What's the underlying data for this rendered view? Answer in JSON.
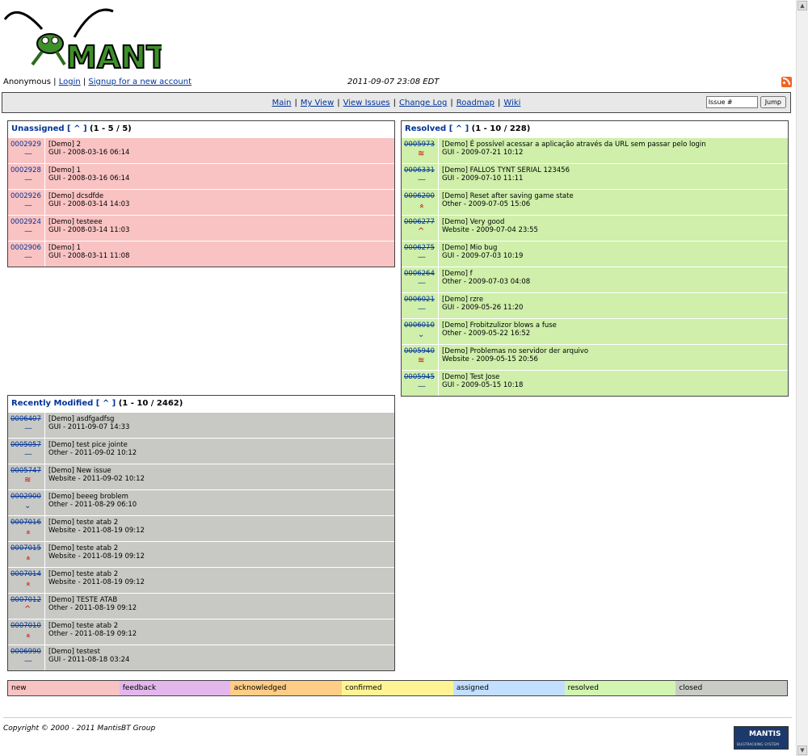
{
  "header": {
    "logo_text": "MANTIS",
    "user": "Anonymous",
    "login": "Login",
    "signup": "Signup for a new account",
    "datetime": "2011-09-07 23:08 EDT",
    "rss_icon": "rss-feed-icon"
  },
  "menu": {
    "items": [
      "Main",
      "My View",
      "View Issues",
      "Change Log",
      "Roadmap",
      "Wiki"
    ],
    "jump_placeholder": "Issue #",
    "jump_value": "Issue #",
    "jump_button": "Jump"
  },
  "colors": {
    "unassigned": "#f9c3c3",
    "resolved": "#cfefaa",
    "recent": "#c8c9c4",
    "priority_icon": "#cc0000"
  },
  "unassigned": {
    "title": "Unassigned",
    "caret": "[ ^ ]",
    "count": "(1 - 5 / 5)",
    "rows": [
      {
        "id": "0002929",
        "summary": "[Demo] 2",
        "meta": "GUI - 2008-03-16 06:14",
        "priority": "normal"
      },
      {
        "id": "0002928",
        "summary": "[Demo] 1",
        "meta": "GUI - 2008-03-16 06:14",
        "priority": "normal"
      },
      {
        "id": "0002926",
        "summary": "[Demo] dcsdfde",
        "meta": "GUI - 2008-03-14 14:03",
        "priority": "normal"
      },
      {
        "id": "0002924",
        "summary": "[Demo] testeee",
        "meta": "GUI - 2008-03-14 11:03",
        "priority": "normal"
      },
      {
        "id": "0002906",
        "summary": "[Demo] 1",
        "meta": "GUI - 2008-03-11 11:08",
        "priority": "normal"
      }
    ]
  },
  "resolved": {
    "title": "Resolved",
    "caret": "[ ^ ]",
    "count": "(1 - 10 / 228)",
    "rows": [
      {
        "id": "0005973",
        "summary": "[Demo] É possível acessar a aplicação através da URL sem passar pelo login",
        "meta": "GUI - 2009-07-21 10:12",
        "priority": "urgent"
      },
      {
        "id": "0006331",
        "summary": "[Demo] FALLOS TYNT SERIAL 123456",
        "meta": "GUI - 2009-07-10 11:11",
        "priority": "normal"
      },
      {
        "id": "0006200",
        "summary": "[Demo] Reset after saving game state",
        "meta": "Other - 2009-07-05 15:06",
        "priority": "high"
      },
      {
        "id": "0006277",
        "summary": "[Demo] Very good",
        "meta": "Website - 2009-07-04 23:55",
        "priority": "high1"
      },
      {
        "id": "0006275",
        "summary": "[Demo] Mio bug",
        "meta": "GUI - 2009-07-03 10:19",
        "priority": "normal"
      },
      {
        "id": "0006264",
        "summary": "[Demo] f",
        "meta": "Other - 2009-07-03 04:08",
        "priority": "normal"
      },
      {
        "id": "0006021",
        "summary": "[Demo] rzre",
        "meta": "GUI - 2009-05-26 11:20",
        "priority": "normal"
      },
      {
        "id": "0006010",
        "summary": "[Demo] Frobitzulizor blows a fuse",
        "meta": "Other - 2009-05-22 16:52",
        "priority": "low"
      },
      {
        "id": "0005940",
        "summary": "[Demo] Problemas no servidor der arquivo",
        "meta": "Website - 2009-05-15 20:56",
        "priority": "urgent"
      },
      {
        "id": "0005945",
        "summary": "[Demo] Test Jose",
        "meta": "GUI - 2009-05-15 10:18",
        "priority": "normal"
      }
    ]
  },
  "recent": {
    "title": "Recently Modified",
    "caret": "[ ^ ]",
    "count": "(1 - 10 / 2462)",
    "rows": [
      {
        "id": "0006407",
        "summary": "[Demo] asdfgadfsg",
        "meta": "GUI - 2011-09-07 14:33",
        "priority": "normal"
      },
      {
        "id": "0005057",
        "summary": "[Demo] test pice jointe",
        "meta": "Other - 2011-09-02 10:12",
        "priority": "normal"
      },
      {
        "id": "0005747",
        "summary": "[Demo] New issue",
        "meta": "Website - 2011-09-02 10:12",
        "priority": "urgent"
      },
      {
        "id": "0002900",
        "summary": "[Demo] beeeg broblem",
        "meta": "Other - 2011-08-29 06:10",
        "priority": "low"
      },
      {
        "id": "0007016",
        "summary": "[Demo] teste atab 2",
        "meta": "Website - 2011-08-19 09:12",
        "priority": "high"
      },
      {
        "id": "0007015",
        "summary": "[Demo] teste atab 2",
        "meta": "Website - 2011-08-19 09:12",
        "priority": "high"
      },
      {
        "id": "0007014",
        "summary": "[Demo] teste atab 2",
        "meta": "Website - 2011-08-19 09:12",
        "priority": "high"
      },
      {
        "id": "0007012",
        "summary": "[Demo] TESTE ATAB",
        "meta": "Other - 2011-08-19 09:12",
        "priority": "high1"
      },
      {
        "id": "0007010",
        "summary": "[Demo] teste atab 2",
        "meta": "Other - 2011-08-19 09:12",
        "priority": "high"
      },
      {
        "id": "0006990",
        "summary": "[Demo] testest",
        "meta": "GUI - 2011-08-18 03:24",
        "priority": "normal"
      }
    ]
  },
  "legend": [
    {
      "label": "new",
      "color": "#f9c3c3"
    },
    {
      "label": "feedback",
      "color": "#e3b7eb"
    },
    {
      "label": "acknowledged",
      "color": "#ffcd85"
    },
    {
      "label": "confirmed",
      "color": "#fff494"
    },
    {
      "label": "assigned",
      "color": "#c2dfff"
    },
    {
      "label": "resolved",
      "color": "#d2f5b0"
    },
    {
      "label": "closed",
      "color": "#c9ccc4"
    }
  ],
  "footer": {
    "copyright": "Copyright © 2000 - 2011 MantisBT Group",
    "powered_logo_text": "MANTIS",
    "powered_logo_sub": "BUGTRACKING SYSTEM"
  }
}
